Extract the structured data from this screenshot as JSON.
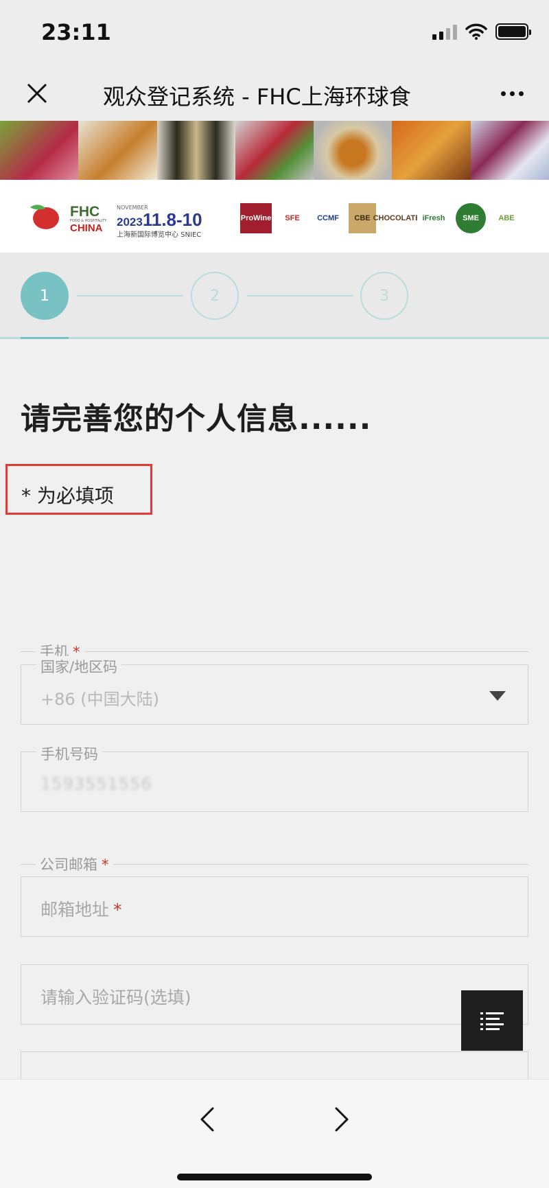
{
  "status_bar": {
    "time": "23:11"
  },
  "nav": {
    "title": "观众登记系统 - FHC上海环球食"
  },
  "banner": {
    "fhc": "FHC",
    "fhc_sub": "FOOD & HOSPITALITY",
    "china": "CHINA",
    "month": "NOVEMBER",
    "year": "2023",
    "dates": "11.8-10",
    "venue": "上海新国际博览中心 SNIEC",
    "partners": [
      {
        "text": "ProWine",
        "bg": "#a01e2e",
        "color": "#ffffff"
      },
      {
        "text": "SFE",
        "bg": "#ffffff",
        "color": "#c62828"
      },
      {
        "text": "CCMF",
        "bg": "#ffffff",
        "color": "#1e3a8a"
      },
      {
        "text": "CBE",
        "bg": "#c9a86a",
        "color": "#3b2a12"
      },
      {
        "text": "CHOCOLATE",
        "bg": "#ffffff",
        "color": "#5b3a1e"
      },
      {
        "text": "iFresh",
        "bg": "#ffffff",
        "color": "#2e7d32"
      },
      {
        "text": "SME",
        "bg": "#2e7d32",
        "color": "#ffffff"
      },
      {
        "text": "ABE",
        "bg": "#ffffff",
        "color": "#6aa336"
      }
    ]
  },
  "stepper": {
    "steps": [
      "1",
      "2",
      "3"
    ],
    "active": 1
  },
  "form": {
    "heading": "请完善您的个人信息......",
    "required_note": "* 为必填项",
    "phone_group_label": "手机",
    "country_code_legend": "国家/地区码",
    "country_code_value": "+86 (中国大陆)",
    "phone_number_legend": "手机号码",
    "phone_number_value": "1593551556",
    "email_group_label": "公司邮箱",
    "email_placeholder": "邮箱地址",
    "verification_placeholder": "请输入验证码(选填)",
    "required_mark": "*"
  },
  "colors": {
    "accent": "#79c2c4",
    "required": "#c0392b",
    "highlight_box": "#e53935"
  }
}
